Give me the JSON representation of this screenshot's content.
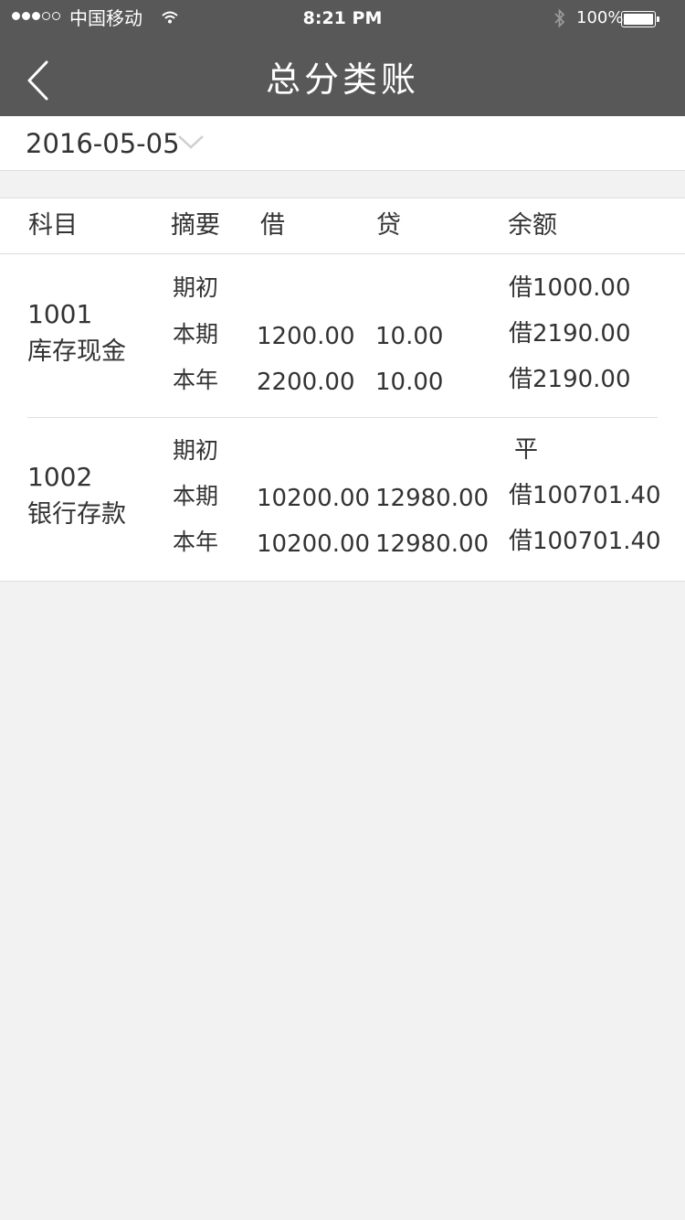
{
  "status_bar": {
    "carrier": "中国移动",
    "time": "8:21 PM",
    "battery_percent": "100%",
    "signal_strength": 3,
    "signal_total": 5,
    "battery_level": 1.0
  },
  "nav": {
    "title": "总分类账",
    "back_icon": "chevron-left-icon"
  },
  "date_selector": {
    "value": "2016-05-05",
    "dropdown_icon": "chevron-down-icon"
  },
  "table": {
    "headers": {
      "subject": "科目",
      "summary": "摘要",
      "debit": "借",
      "credit": "贷",
      "balance": "余额"
    },
    "accounts": [
      {
        "code": "1001",
        "name": "库存现金",
        "rows": [
          {
            "summary": "期初",
            "debit": "",
            "credit": "",
            "balance": "借1000.00"
          },
          {
            "summary": "本期",
            "debit": "1200.00",
            "credit": "10.00",
            "balance": "借2190.00"
          },
          {
            "summary": "本年",
            "debit": "2200.00",
            "credit": "10.00",
            "balance": "借2190.00"
          }
        ]
      },
      {
        "code": "1002",
        "name": "银行存款",
        "rows": [
          {
            "summary": "期初",
            "debit": "",
            "credit": "",
            "balance": "平"
          },
          {
            "summary": "本期",
            "debit": "10200.00",
            "credit": "12980.00",
            "balance": "借100701.40"
          },
          {
            "summary": "本年",
            "debit": "10200.00",
            "credit": "12980.00",
            "balance": "借100701.40"
          }
        ]
      }
    ]
  },
  "colors": {
    "nav_background": "#585858",
    "page_background": "#f2f2f2",
    "text": "#333333",
    "divider": "#dedede"
  }
}
